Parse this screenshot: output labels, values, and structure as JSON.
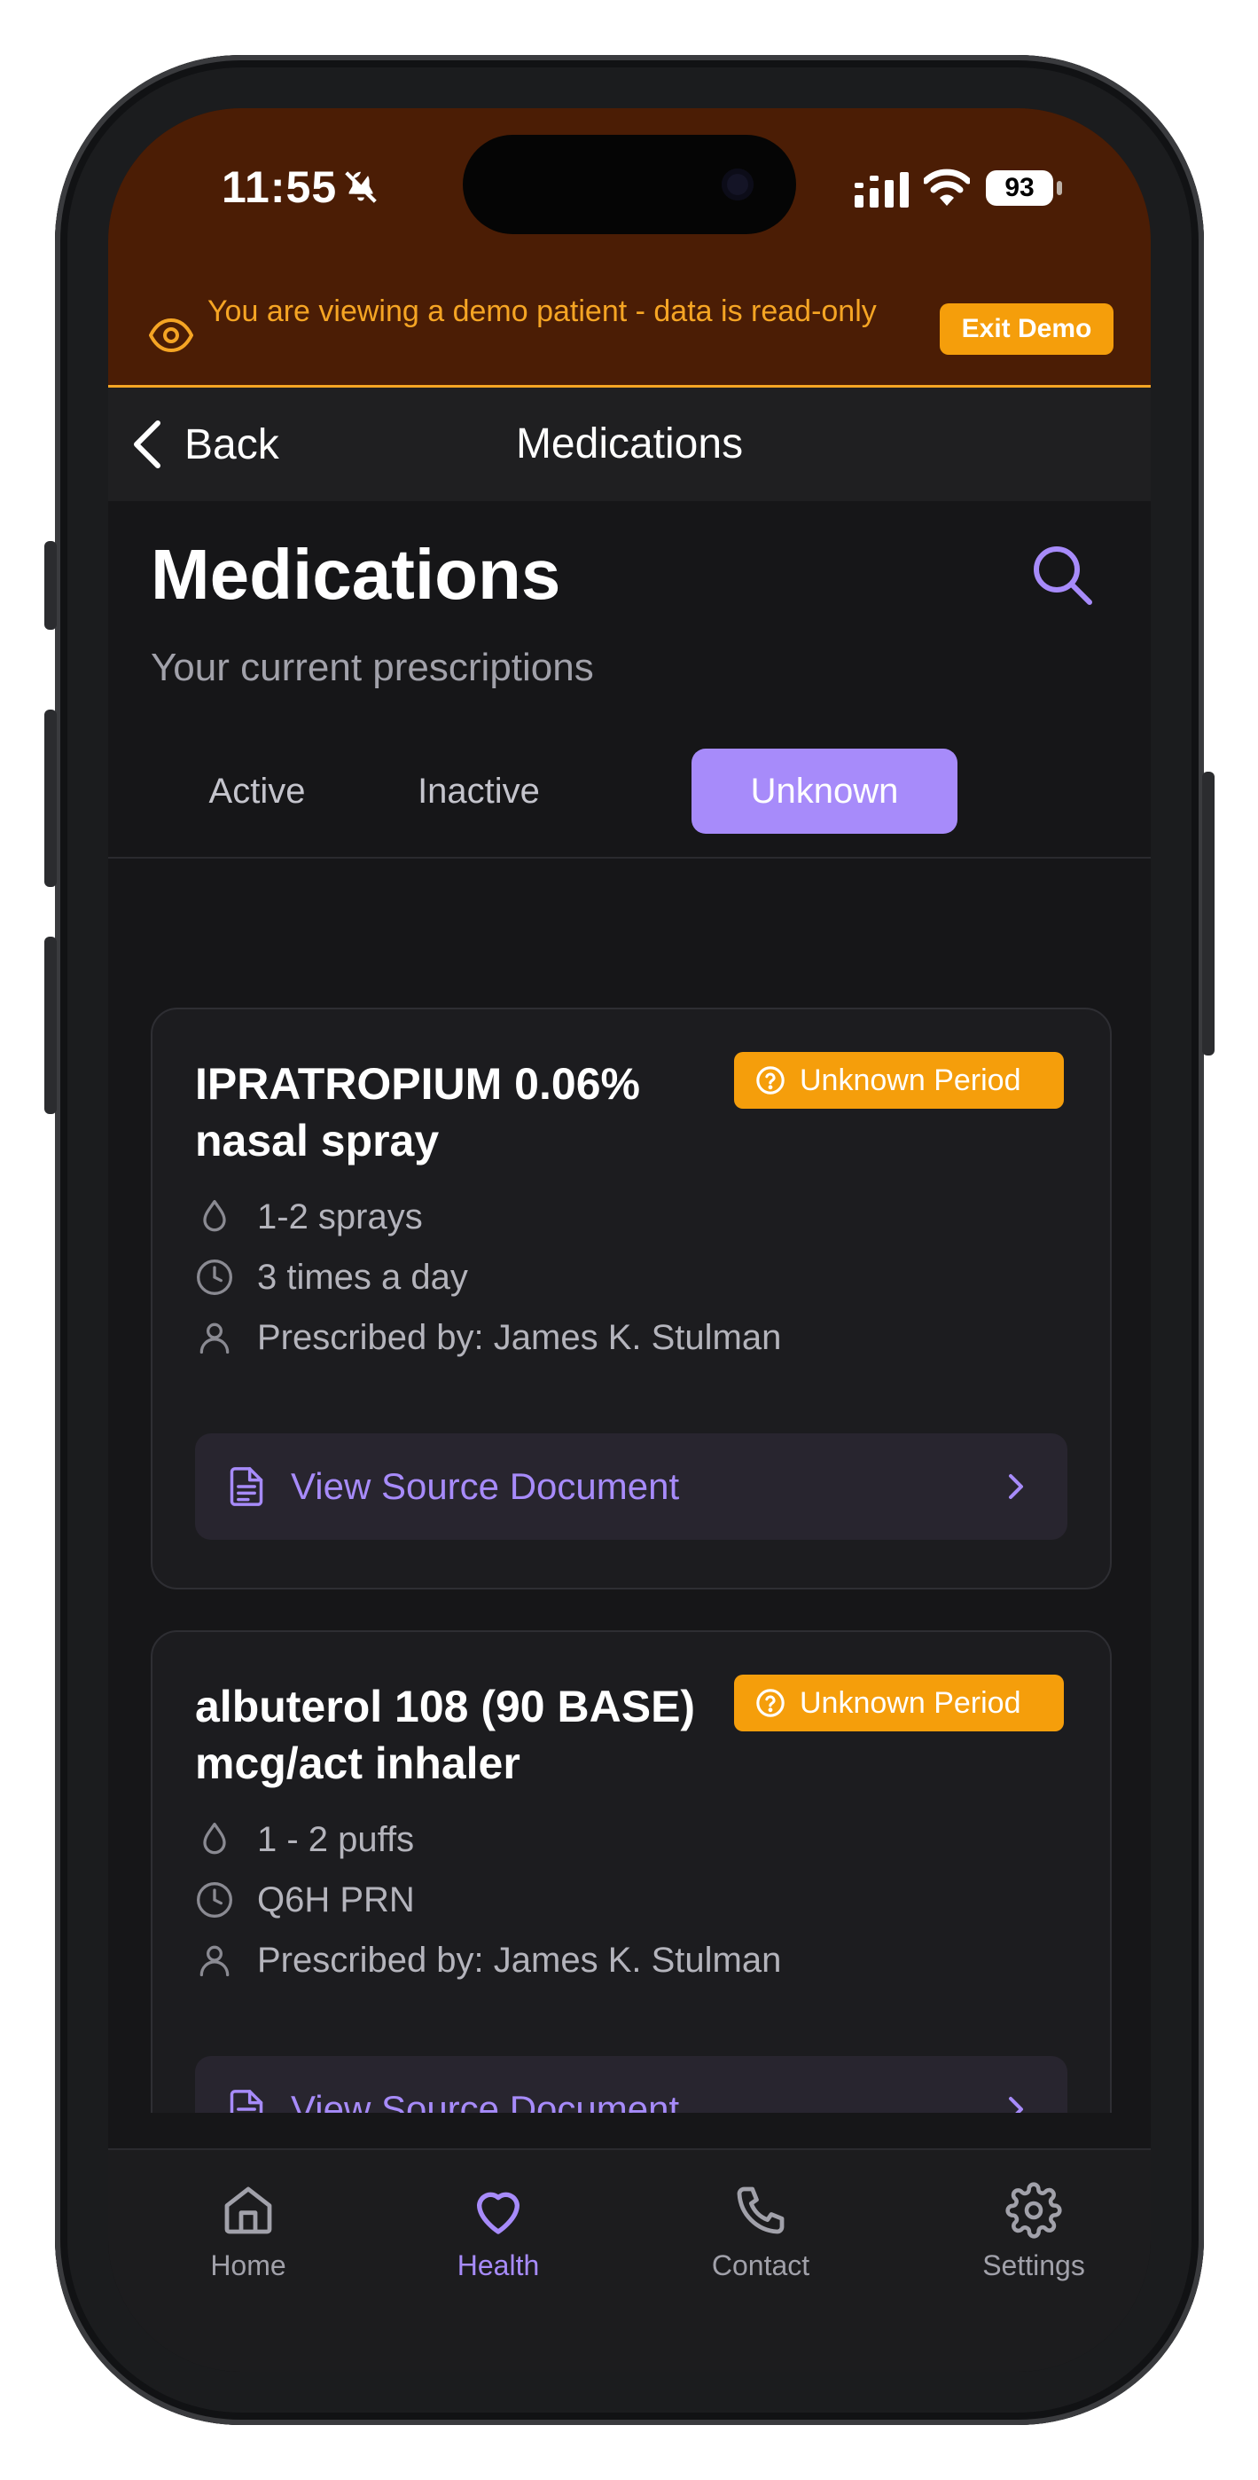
{
  "status_bar": {
    "time": "11:55",
    "battery": "93"
  },
  "demo_banner": {
    "message": "You are viewing a demo patient - data is read-only",
    "exit_label": "Exit Demo",
    "color": "#f5a524"
  },
  "nav": {
    "back_label": "Back",
    "title": "Medications"
  },
  "header": {
    "title": "Medications",
    "subtitle": "Your current prescriptions"
  },
  "tabs": [
    {
      "label": "Active",
      "selected": false
    },
    {
      "label": "Inactive",
      "selected": false
    },
    {
      "label": "Unknown",
      "selected": true
    }
  ],
  "medications": [
    {
      "name": "IPRATROPIUM 0.06% nasal spray",
      "badge": "Unknown Period",
      "dose": "1-2 sprays",
      "frequency": "3 times a day",
      "prescriber": "Prescribed by: James K. Stulman",
      "source_label": "View Source Document"
    },
    {
      "name": "albuterol 108 (90 BASE) mcg/act inhaler",
      "badge": "Unknown Period",
      "dose": "1 - 2 puffs",
      "frequency": "Q6H PRN",
      "prescriber": "Prescribed by: James K. Stulman",
      "source_label": "View Source Document"
    }
  ],
  "bottom_nav": [
    {
      "label": "Home",
      "icon": "home-icon",
      "active": false
    },
    {
      "label": "Health",
      "icon": "heart-icon",
      "active": true
    },
    {
      "label": "Contact",
      "icon": "phone-icon",
      "active": false
    },
    {
      "label": "Settings",
      "icon": "gear-icon",
      "active": false
    }
  ],
  "colors": {
    "accent": "#a78bfa",
    "warning": "#f59e0b",
    "background": "#161618",
    "banner": "#4b1d05"
  }
}
